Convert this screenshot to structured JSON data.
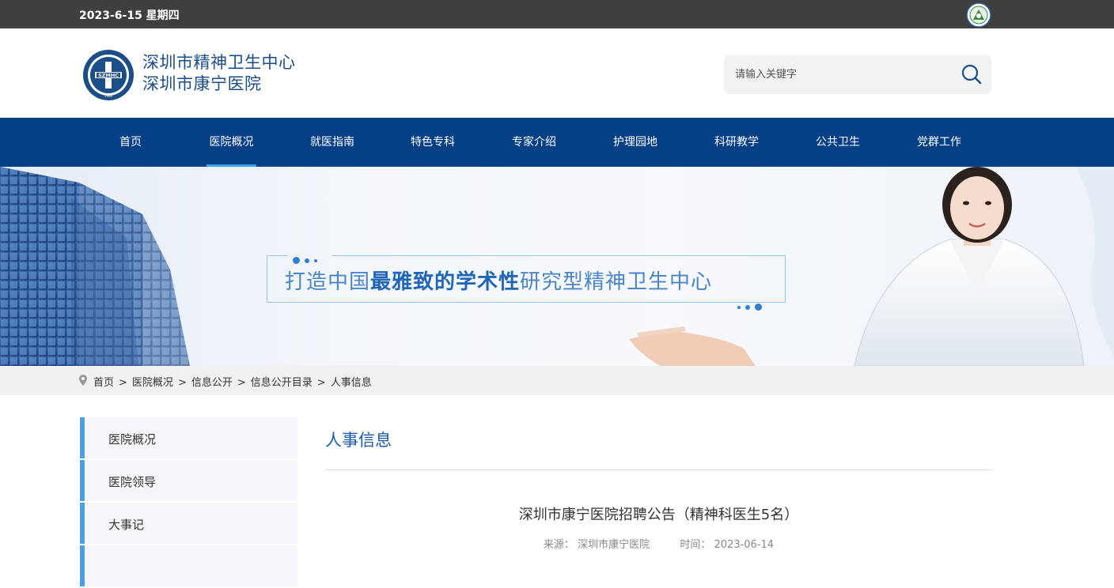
{
  "topbar": {
    "date": "2023-6-15 星期四",
    "badge_icon": "hospital-accreditation-badge"
  },
  "header": {
    "logo_line1": "深圳市精神卫生中心",
    "logo_line2": "深圳市康宁医院",
    "logo_emblem_text": "SZMHC",
    "logo_emblem_year": "1986",
    "search_placeholder": "请输入关键字",
    "search_icon": "search-icon"
  },
  "nav": {
    "items": [
      {
        "label": "首页",
        "active": false
      },
      {
        "label": "医院概况",
        "active": true
      },
      {
        "label": "就医指南",
        "active": false
      },
      {
        "label": "特色专科",
        "active": false
      },
      {
        "label": "专家介绍",
        "active": false
      },
      {
        "label": "护理园地",
        "active": false
      },
      {
        "label": "科研教学",
        "active": false
      },
      {
        "label": "公共卫生",
        "active": false
      },
      {
        "label": "党群工作",
        "active": false
      }
    ],
    "bg_color": "#053f86",
    "active_underline_color": "#3aa0e8"
  },
  "banner": {
    "slogan_pre": "打造中国",
    "slogan_bold": "最雅致的学术性",
    "slogan_post": "研究型精神卫生中心"
  },
  "breadcrumb": {
    "items": [
      "首页",
      "医院概况",
      "信息公开",
      "信息公开目录",
      "人事信息"
    ],
    "separator": ">"
  },
  "sidebar": {
    "items": [
      "医院概况",
      "医院领导",
      "大事记"
    ]
  },
  "content": {
    "section_title": "人事信息",
    "article_title": "深圳市康宁医院招聘公告（精神科医生5名）",
    "source_label": "来源：",
    "source_value": "深圳市康宁医院",
    "time_label": "时间：",
    "time_value": "2023-06-14"
  }
}
